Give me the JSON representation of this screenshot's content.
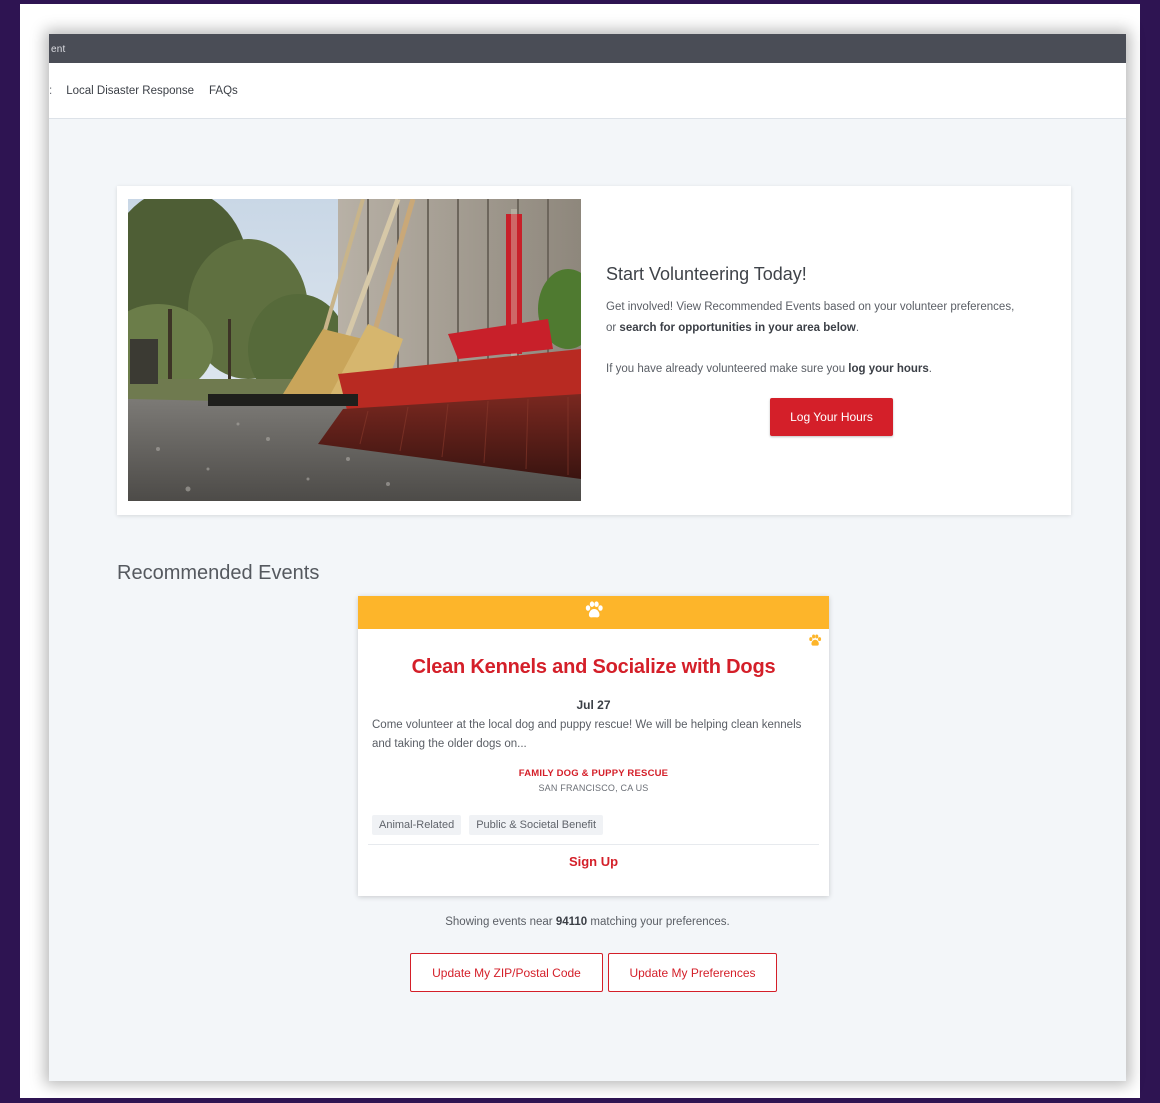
{
  "window": {
    "title_fragment": "ent"
  },
  "nav": {
    "stub": ":",
    "items": [
      {
        "label": "Local Disaster Response"
      },
      {
        "label": "FAQs"
      }
    ]
  },
  "hero": {
    "title": "Start Volunteering Today!",
    "para1_plain": "Get involved! View Recommended Events based on your volunteer preferences, or ",
    "para1_bold": "search for opportunities in your area below",
    "para1_end": ".",
    "para2_plain": "If you have already volunteered make sure you ",
    "para2_bold": "log your hours",
    "para2_end": ".",
    "button_label": "Log Your Hours"
  },
  "recommended": {
    "section_title": "Recommended Events",
    "event": {
      "header_icon": "paw-icon",
      "corner_icon": "paw-icon",
      "header_color": "#fdb52a",
      "title": "Clean Kennels and Socialize with Dogs",
      "date": "Jul 27",
      "description": "Come volunteer at the local dog and puppy rescue! We will be helping clean kennels and taking the older dogs on...",
      "organization": "FAMILY DOG & PUPPY RESCUE",
      "location": "SAN FRANCISCO, CA US",
      "tags": [
        "Animal-Related",
        "Public & Societal Benefit"
      ],
      "action_label": "Sign Up"
    },
    "note_prefix": "Showing events near ",
    "note_zip": "94110",
    "note_suffix": " matching your preferences.",
    "buttons": {
      "zip_label": "Update My ZIP/Postal Code",
      "prefs_label": "Update My Preferences"
    }
  },
  "colors": {
    "accent": "#d41f29",
    "title_bar": "#4a4d56",
    "page_background": "#f3f6f9",
    "frame_background": "#2e1452"
  }
}
